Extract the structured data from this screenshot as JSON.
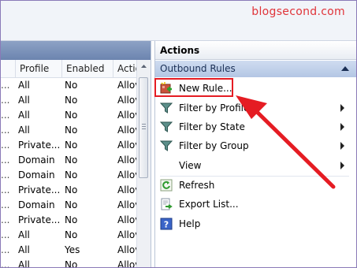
{
  "watermark": "blogsecond.com",
  "table": {
    "columns": [
      "",
      "Profile",
      "Enabled",
      "Actio"
    ],
    "rows": [
      [
        "...",
        "All",
        "No",
        "Allov"
      ],
      [
        "...",
        "All",
        "No",
        "Allov"
      ],
      [
        "...",
        "All",
        "No",
        "Allov"
      ],
      [
        "...",
        "All",
        "No",
        "Allov"
      ],
      [
        "...",
        "Private...",
        "No",
        "Allov"
      ],
      [
        "...",
        "Domain",
        "No",
        "Allov"
      ],
      [
        "...",
        "Domain",
        "No",
        "Allov"
      ],
      [
        "...",
        "Private...",
        "No",
        "Allov"
      ],
      [
        "...",
        "Domain",
        "No",
        "Allov"
      ],
      [
        "...",
        "Private...",
        "No",
        "Allov"
      ],
      [
        "...",
        "All",
        "No",
        "Allov"
      ],
      [
        "...",
        "All",
        "Yes",
        "Allov"
      ],
      [
        "...",
        "All",
        "No",
        "Allov"
      ]
    ]
  },
  "actions": {
    "title": "Actions",
    "section": "Outbound Rules",
    "items": [
      {
        "label": "New Rule...",
        "icon": "new-rule-icon"
      },
      {
        "label": "Filter by Profile",
        "icon": "filter-icon"
      },
      {
        "label": "Filter by State",
        "icon": "filter-icon"
      },
      {
        "label": "Filter by Group",
        "icon": "filter-icon"
      },
      {
        "label": "View",
        "icon": ""
      },
      {
        "label": "Refresh",
        "icon": "refresh-icon"
      },
      {
        "label": "Export List...",
        "icon": "export-icon"
      },
      {
        "label": "Help",
        "icon": "help-icon"
      }
    ]
  },
  "colors": {
    "highlight": "#e51c23",
    "section_bg": "#b3c6e4",
    "header_bg": "#6c84af"
  }
}
